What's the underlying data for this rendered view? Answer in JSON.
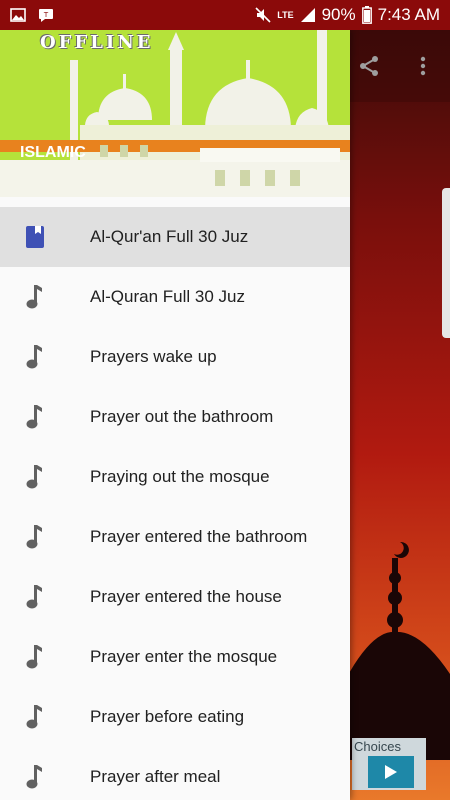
{
  "status_bar": {
    "battery": "90%",
    "time": "7:43 AM",
    "network": "LTE",
    "icons": [
      "image-icon",
      "talk-icon",
      "mute-icon",
      "signal-icon",
      "battery-icon"
    ]
  },
  "drawer": {
    "header_top_text": "OFFLINE",
    "header_title": "ISLAMIC",
    "items": [
      {
        "label": "Al-Qur'an Full 30 Juz",
        "icon": "book-icon",
        "selected": true
      },
      {
        "label": "Al-Quran Full 30 Juz",
        "icon": "music-note-icon"
      },
      {
        "label": "Prayers wake up",
        "icon": "music-note-icon"
      },
      {
        "label": "Prayer out the bathroom",
        "icon": "music-note-icon"
      },
      {
        "label": "Praying out the mosque",
        "icon": "music-note-icon"
      },
      {
        "label": "Prayer entered the bathroom",
        "icon": "music-note-icon"
      },
      {
        "label": "Prayer entered the house",
        "icon": "music-note-icon"
      },
      {
        "label": "Prayer enter the mosque",
        "icon": "music-note-icon"
      },
      {
        "label": "Prayer before eating",
        "icon": "music-note-icon"
      },
      {
        "label": "Prayer after meal",
        "icon": "music-note-icon"
      }
    ]
  },
  "background_app": {
    "toolbar_icons": [
      "share-icon",
      "more-vert-icon"
    ],
    "ad": {
      "label": "Choices"
    }
  },
  "colors": {
    "status_bar": "#8b0a0a",
    "header_green": "#b7e23b",
    "selected_row": "#e0e0e0",
    "book_icon": "#3f51b5",
    "note_icon": "#616161"
  }
}
